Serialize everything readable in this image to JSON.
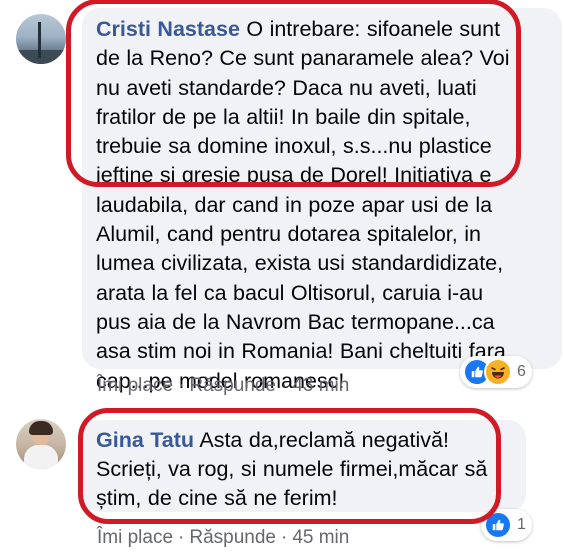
{
  "comments": [
    {
      "author": "Cristi Nastase",
      "text": " O intrebare: sifoanele sunt\nde la Reno? Ce sunt panaramele alea? Voi\nnu aveti standarde? Daca nu aveti, luati\nfratilor de pe la altii! In baile din spitale,\ntrebuie sa domine inoxul, s.s...nu plastice\nieftine si gresie pusa de Dorel! Initiativa e\nlaudabila, dar cand in poze apar usi de la\nAlumil, cand pentru dotarea spitalelor, in\nlumea civilizata, exista usi standardidizate,\narata la fel ca bacul Oltisorul, caruia i-au\npus aia de la Navrom Bac termopane...ca\nasa stim noi in Romania! Bani cheltuiti fara\ncap...pe model romanesc!",
      "like_label": "Îmi place",
      "reply_label": "Răspunde",
      "time": "43 min",
      "reaction_count": "6",
      "reactions": [
        "like-icon",
        "haha-icon"
      ]
    },
    {
      "author": "Gina Tatu",
      "text": " Asta da,reclamă negativă!\nScrieți, va rog, si numele firmei,măcar să\nștim, de cine să ne ferim!",
      "like_label": "Îmi place",
      "reply_label": "Răspunde",
      "time": "45 min",
      "reaction_count": "1",
      "reactions": [
        "like-icon"
      ]
    }
  ],
  "separator": "·",
  "colors": {
    "author": "#385898",
    "bubble": "#f0f2f5",
    "meta": "#65676b",
    "highlight": "#d11a26",
    "like": "#1877f2",
    "haha": "#f7b125"
  }
}
